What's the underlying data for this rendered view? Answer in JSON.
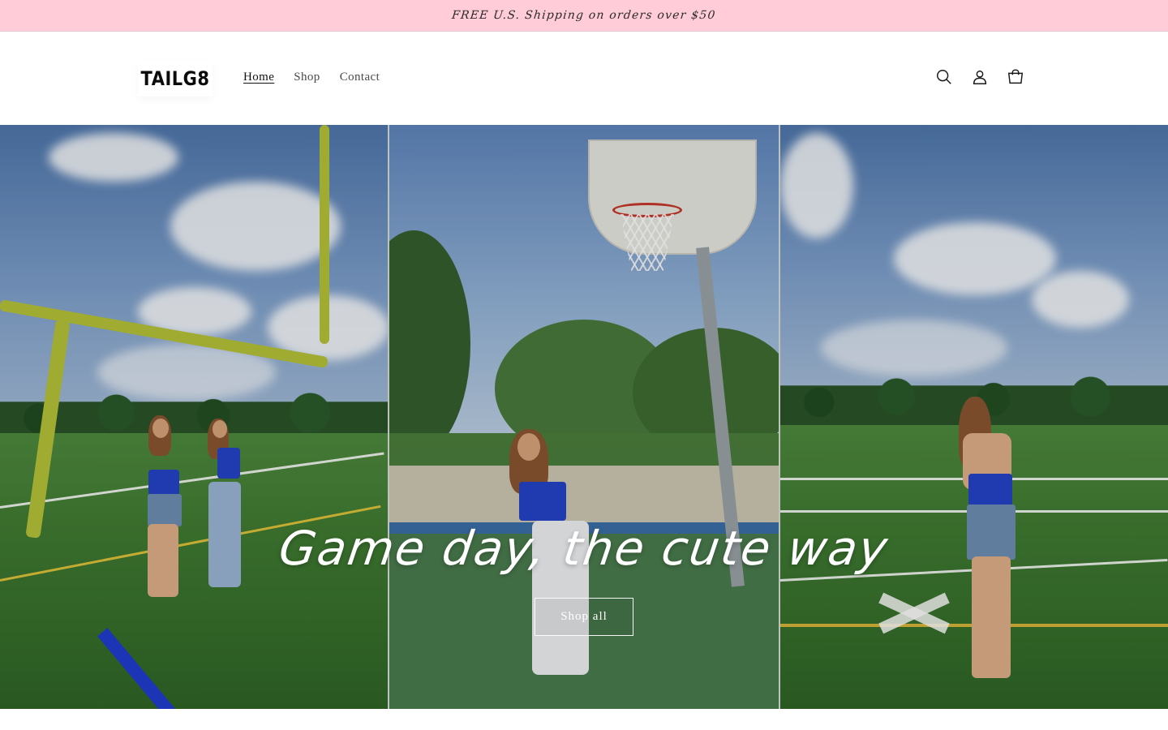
{
  "announcement": {
    "text": "FREE U.S. Shipping on orders over $50"
  },
  "header": {
    "logo_text": "TAILG8",
    "nav": [
      {
        "label": "Home",
        "active": true
      },
      {
        "label": "Shop",
        "active": false
      },
      {
        "label": "Contact",
        "active": false
      }
    ],
    "icons": [
      "search-icon",
      "account-icon",
      "cart-icon"
    ]
  },
  "hero": {
    "title": "Game day, the cute way",
    "button_label": "Shop all"
  },
  "colors": {
    "announcement_bg": "#ffccd8",
    "hero_text": "#ffffff",
    "accent_blue": "#2543c9"
  }
}
